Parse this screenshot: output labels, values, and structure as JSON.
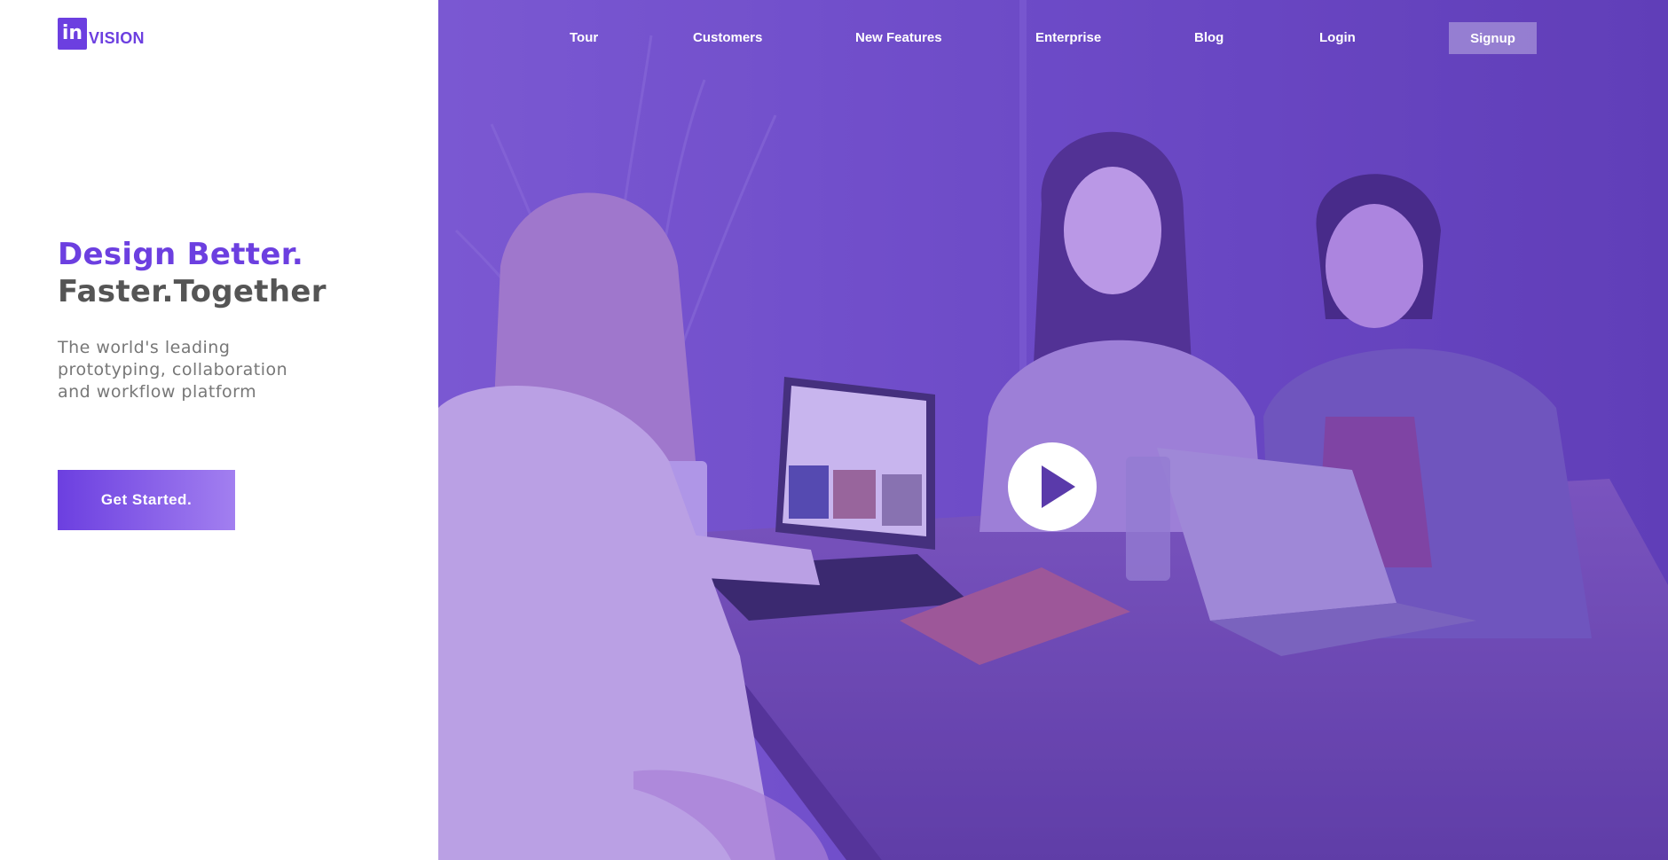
{
  "brand": {
    "logo_mark": "in",
    "logo_word": "VISION",
    "accent_color": "#6c3fe0"
  },
  "hero_text": {
    "headline_line1": "Design Better.",
    "headline_line2": "Faster.Together",
    "subtext": "The world's leading prototyping, collaboration and workflow platform",
    "cta_label": "Get Started."
  },
  "nav": {
    "items": [
      {
        "label": "Tour"
      },
      {
        "label": "Customers"
      },
      {
        "label": "New Features"
      },
      {
        "label": "Enterprise"
      },
      {
        "label": "Blog"
      },
      {
        "label": "Login"
      }
    ],
    "signup_label": "Signup"
  },
  "hero_media": {
    "play_icon": "play-icon",
    "overlay_color": "#6a49c4"
  }
}
